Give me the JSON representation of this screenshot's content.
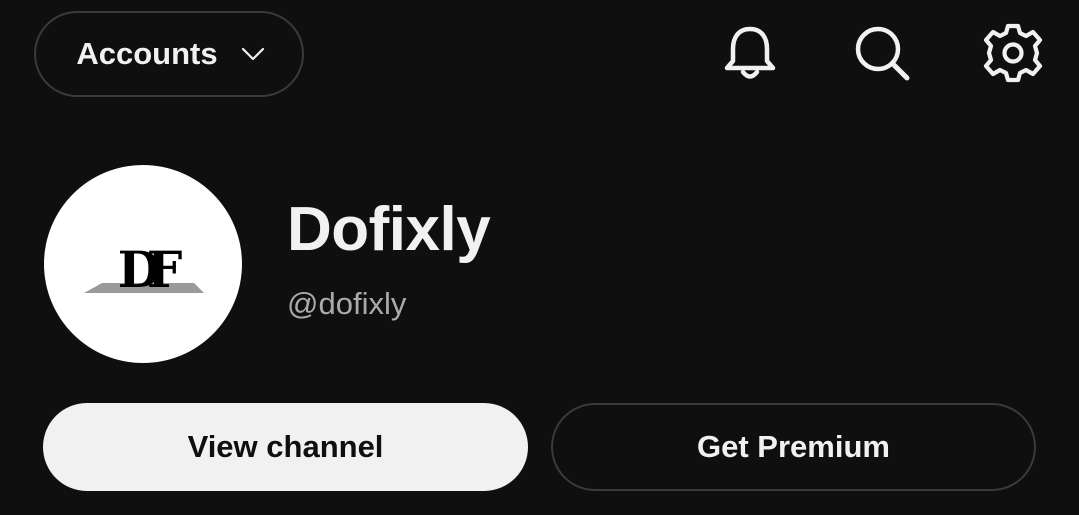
{
  "header": {
    "accounts_label": "Accounts",
    "accounts_icon": "chevron-down-icon",
    "icons": [
      "bell-icon",
      "search-icon",
      "gear-icon"
    ]
  },
  "channel": {
    "name": "Dofixly",
    "handle": "@dofixly",
    "avatar_logo_text": "DF"
  },
  "actions": {
    "view_channel_label": "View channel",
    "get_premium_label": "Get Premium"
  },
  "colors": {
    "background": "#0f0f0f",
    "text_primary": "#f1f1f1",
    "text_secondary": "#aaaaaa",
    "outline": "#3a3a3a",
    "light_button": "#f1f1f1"
  }
}
